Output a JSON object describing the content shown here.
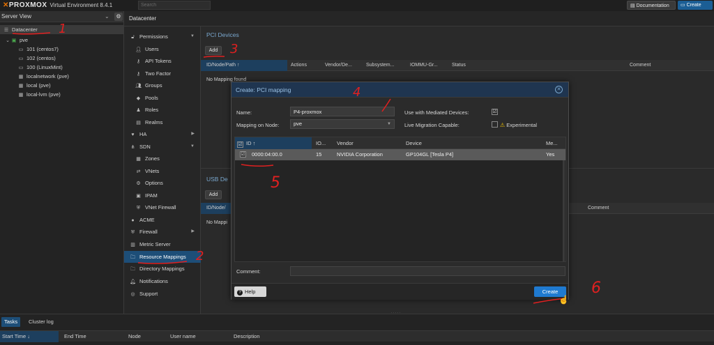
{
  "topbar": {
    "logo_brand": "PROXMOX",
    "logo_product": "Virtual Environment 8.4.1",
    "search_placeholder": "Search",
    "documentation_label": "Documentation",
    "create_vm_label": "Create VM"
  },
  "server_view": {
    "header": "Server View",
    "tree": [
      {
        "label": "Datacenter",
        "icon": "datacenter-icon"
      },
      {
        "label": "pve",
        "icon": "node-icon"
      },
      {
        "label": "101 (centos7)",
        "icon": "vm-icon"
      },
      {
        "label": "102 (centos)",
        "icon": "vm-icon"
      },
      {
        "label": "100 (LinuxMint)",
        "icon": "vm-icon"
      },
      {
        "label": "localnetwork (pve)",
        "icon": "storage-icon"
      },
      {
        "label": "local (pve)",
        "icon": "storage-icon"
      },
      {
        "label": "local-lvm (pve)",
        "icon": "storage-icon"
      }
    ]
  },
  "datacenter_header": "Datacenter",
  "nav": {
    "items": [
      {
        "label": "Permissions",
        "icon": "unlock-icon",
        "arrow": true
      },
      {
        "label": "Users",
        "icon": "user-icon"
      },
      {
        "label": "API Tokens",
        "icon": "key-icon"
      },
      {
        "label": "Two Factor",
        "icon": "key-icon"
      },
      {
        "label": "Groups",
        "icon": "group-icon"
      },
      {
        "label": "Pools",
        "icon": "pool-icon"
      },
      {
        "label": "Roles",
        "icon": "role-icon"
      },
      {
        "label": "Realms",
        "icon": "realm-icon"
      },
      {
        "label": "HA",
        "icon": "ha-icon",
        "arrow": true
      },
      {
        "label": "SDN",
        "icon": "sdn-icon",
        "arrow": true
      },
      {
        "label": "Zones",
        "icon": "zones-icon"
      },
      {
        "label": "VNets",
        "icon": "vnets-icon"
      },
      {
        "label": "Options",
        "icon": "gear-icon"
      },
      {
        "label": "IPAM",
        "icon": "ipam-icon"
      },
      {
        "label": "VNet Firewall",
        "icon": "shield-icon"
      },
      {
        "label": "ACME",
        "icon": "acme-icon"
      },
      {
        "label": "Firewall",
        "icon": "shield-icon",
        "arrow": true
      },
      {
        "label": "Metric Server",
        "icon": "chart-icon"
      },
      {
        "label": "Resource Mappings",
        "icon": "folder-icon"
      },
      {
        "label": "Directory Mappings",
        "icon": "folder-icon"
      },
      {
        "label": "Notifications",
        "icon": "bell-icon"
      },
      {
        "label": "Support",
        "icon": "support-icon"
      }
    ]
  },
  "pci_panel": {
    "title": "PCI Devices",
    "add_label": "Add",
    "columns": [
      "ID/Node/Path ↑",
      "Actions",
      "Vendor/De...",
      "Subsystem...",
      "IOMMU-Gr...",
      "Status",
      "Comment"
    ],
    "empty_text": "No Mapping found"
  },
  "usb_panel": {
    "title": "USB De",
    "add_label": "Add",
    "columns": [
      "ID/Node/",
      "Comment"
    ],
    "empty_text": "No Mappi"
  },
  "modal": {
    "title": "Create: PCI mapping",
    "name_label": "Name:",
    "name_value": "P4-proxmox",
    "mapping_label": "Mapping on Node:",
    "mapping_value": "pve",
    "mediated_label": "Use with Mediated Devices:",
    "mediated_checked": "☑",
    "migration_label": "Live Migration Capable:",
    "experimental_label": "Experimental",
    "grid_columns": [
      "ID ↑",
      "IO...",
      "Vendor",
      "Device",
      "Me..."
    ],
    "rows": [
      {
        "id": "0000:04:00.0",
        "iommu": "15",
        "vendor": "NVIDIA Corporation",
        "device": "GP104GL [Tesla P4]",
        "mdev": "Yes"
      }
    ],
    "comment_label": "Comment:",
    "help_label": "Help",
    "create_label": "Create"
  },
  "tasks": {
    "tabs": [
      "Tasks",
      "Cluster log"
    ],
    "columns": [
      "Start Time ↓",
      "End Time",
      "Node",
      "User name",
      "Description"
    ]
  },
  "annotations": [
    "1",
    "2",
    "3",
    "4",
    "5",
    "6"
  ],
  "colors": {
    "accent_blue": "#1d4e78",
    "create_blue": "#1f7ad0",
    "annotation_red": "#e02020",
    "brand_orange": "#e57000"
  }
}
